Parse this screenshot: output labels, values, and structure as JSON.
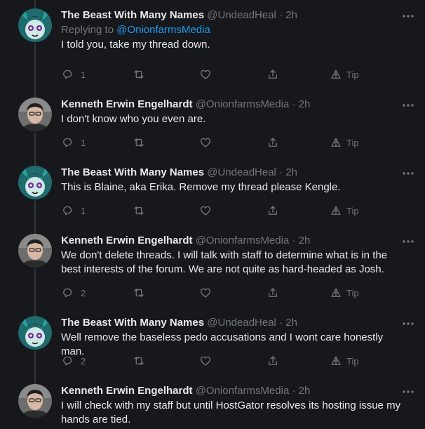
{
  "colors": {
    "background": "#16181c",
    "text": "#e7e9ea",
    "muted": "#71767b",
    "link": "#1d9bf0",
    "divider": "#2f3336"
  },
  "tweets": [
    {
      "name": "The Beast With Many Names",
      "handle": "@UndeadHeal",
      "dot": "·",
      "time": "2h",
      "replying_prefix": "Replying to ",
      "replying_to": "@OnionfarmsMedia",
      "text": "I told you, take my thread down.",
      "reply_count": "1",
      "tip_label": "Tip",
      "avatar": "beast-avatar"
    },
    {
      "name": "Kenneth Erwin Engelhardt",
      "handle": "@OnionfarmsMedia",
      "dot": "·",
      "time": "2h",
      "text": "I don't know who you even are.",
      "reply_count": "1",
      "tip_label": "Tip",
      "avatar": "kenneth-avatar"
    },
    {
      "name": "The Beast With Many Names",
      "handle": "@UndeadHeal",
      "dot": "·",
      "time": "2h",
      "text": "This is Blaine, aka Erika. Remove my thread please Kengle.",
      "reply_count": "1",
      "tip_label": "Tip",
      "avatar": "beast-avatar"
    },
    {
      "name": "Kenneth Erwin Engelhardt",
      "handle": "@OnionfarmsMedia",
      "dot": "·",
      "time": "2h",
      "text": "We don't delete threads. I will talk with staff to determine what is in the best interests of the forum. We are not quite as hard-headed as Josh.",
      "reply_count": "2",
      "tip_label": "Tip",
      "avatar": "kenneth-avatar"
    },
    {
      "name": "The Beast With Many Names",
      "handle": "@UndeadHeal",
      "dot": "·",
      "time": "2h",
      "text": "Well remove the baseless pedo accusations and I wont care honestly man.",
      "reply_count": "2",
      "tip_label": "Tip",
      "avatar": "beast-avatar"
    },
    {
      "name": "Kenneth Erwin Engelhardt",
      "handle": "@OnionfarmsMedia",
      "dot": "·",
      "time": "2h",
      "text": "I will check with my staff but until HostGator resolves its hosting issue my hands are tied.",
      "avatar": "kenneth-avatar"
    }
  ]
}
